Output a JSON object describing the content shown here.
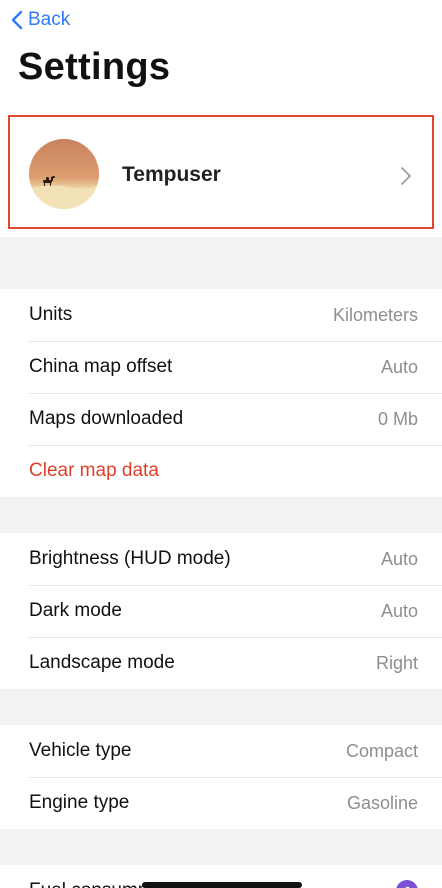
{
  "nav": {
    "back_label": "Back"
  },
  "header": {
    "title": "Settings"
  },
  "profile": {
    "name": "Tempuser"
  },
  "sections": {
    "map": {
      "units_label": "Units",
      "units_value": "Kilometers",
      "china_label": "China map offset",
      "china_value": "Auto",
      "maps_label": "Maps downloaded",
      "maps_value": "0 Mb",
      "clear_label": "Clear map data"
    },
    "display": {
      "brightness_label": "Brightness (HUD mode)",
      "brightness_value": "Auto",
      "dark_label": "Dark mode",
      "dark_value": "Auto",
      "landscape_label": "Landscape mode",
      "landscape_value": "Right"
    },
    "vehicle": {
      "vehicle_label": "Vehicle type",
      "vehicle_value": "Compact",
      "engine_label": "Engine type",
      "engine_value": "Gasoline"
    },
    "fuel": {
      "fuel_label": "Fuel consumption"
    }
  },
  "colors": {
    "accent": "#2f7cf6",
    "danger": "#e0402a",
    "highlight_border": "#e0492f",
    "premium": "#7b4fd6"
  }
}
